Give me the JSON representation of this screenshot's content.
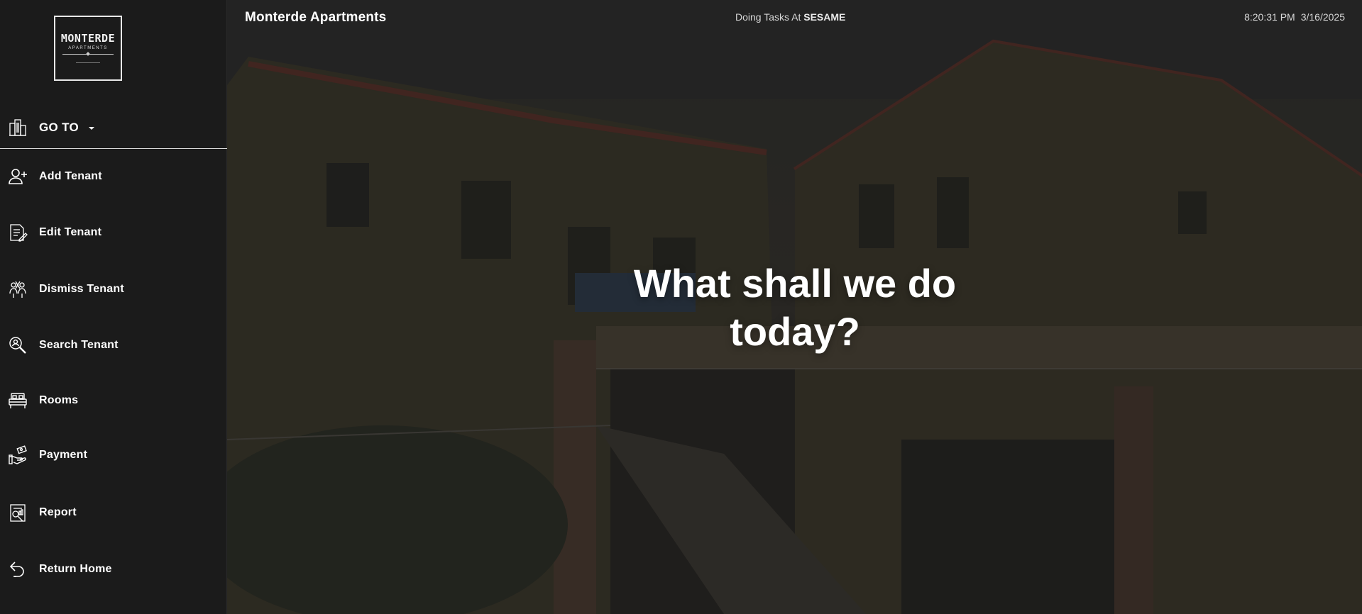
{
  "sidebar": {
    "logo": {
      "name": "MONTERDE",
      "subtitle": "APARTMENTS"
    },
    "goto": {
      "label": "GO TO",
      "icon": "building-icon"
    },
    "items": [
      {
        "label": "Add Tenant",
        "icon": "add-user-icon"
      },
      {
        "label": "Edit Tenant",
        "icon": "edit-document-icon"
      },
      {
        "label": "Dismiss Tenant",
        "icon": "dismiss-people-icon"
      },
      {
        "label": "Search Tenant",
        "icon": "search-user-icon"
      },
      {
        "label": "Rooms",
        "icon": "bed-icon"
      },
      {
        "label": "Payment",
        "icon": "hand-cash-icon"
      },
      {
        "label": "Report",
        "icon": "report-icon"
      },
      {
        "label": "Return Home",
        "icon": "return-arrow-icon"
      }
    ]
  },
  "header": {
    "title": "Monterde Apartments",
    "doing_prefix": "Doing Tasks At",
    "doing_user": "SESAME",
    "time": "8:20:31 PM",
    "date": "3/16/2025"
  },
  "main": {
    "headline": "What shall we do today?"
  },
  "colors": {
    "sidebar_bg": "#1b1b1b",
    "text": "#ffffff",
    "divider": "#d9d9d9"
  }
}
